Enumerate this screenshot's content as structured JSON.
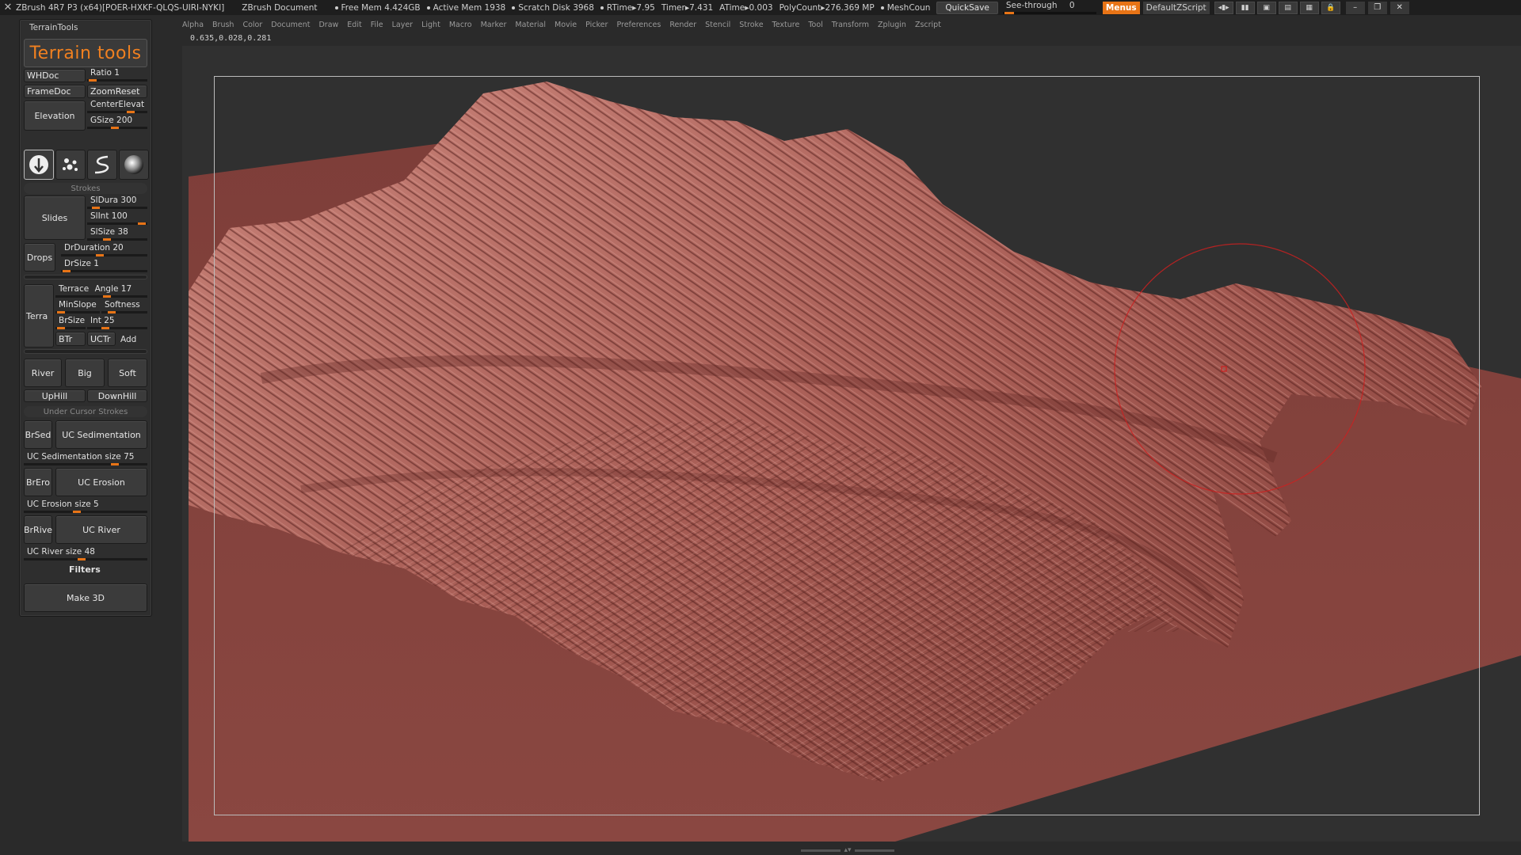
{
  "titlebar": {
    "app_title": "ZBrush 4R7 P3 (x64)[POER-HXKF-QLQS-UIRI-NYKI]",
    "doc_title": "ZBrush Document",
    "stats": [
      "Free Mem 4.424GB",
      "Active Mem 1938",
      "Scratch Disk 3968",
      "RTime▸7.95",
      "Timer▸7.431",
      "ATime▸0.003",
      "PolyCount▸276.369 MP",
      "MeshCoun"
    ],
    "quicksave_label": "QuickSave",
    "seethrough_label": "See-through",
    "seethrough_value": "0",
    "menus_label": "Menus",
    "script_label": "DefaultZScript"
  },
  "menubar": {
    "items": [
      "Alpha",
      "Brush",
      "Color",
      "Document",
      "Draw",
      "Edit",
      "File",
      "Layer",
      "Light",
      "Macro",
      "Marker",
      "Material",
      "Movie",
      "Picker",
      "Preferences",
      "Render",
      "Stencil",
      "Stroke",
      "Texture",
      "Tool",
      "Transform",
      "Zplugin",
      "Zscript"
    ]
  },
  "coords": "0.635,0.028,0.281",
  "palette": {
    "title": "TerrainTools",
    "banner": "Terrain tools",
    "whdoc": "WHDoc",
    "ratio": "Ratio 1",
    "framedoc": "FrameDoc",
    "zoomreset": "ZoomReset",
    "elevation": "Elevation",
    "centerelevat": "CenterElevat",
    "gsize": "GSize 200",
    "strokes_header": "Strokes",
    "slides": "Slides",
    "sldura": "SlDura 300",
    "slint": "SlInt 100",
    "slsize": "SlSize 38",
    "drops": "Drops",
    "drduration": "DrDuration 20",
    "drsize": "DrSize 1",
    "terra": "Terra",
    "terrace": "Terrace",
    "angle": "Angle 17",
    "minslope": "MinSlope",
    "softness": "Softness",
    "brsize": "BrSize",
    "int": "Int 25",
    "btr": "BTr",
    "uctr": "UCTr",
    "add": "Add",
    "river": "River",
    "big": "Big",
    "soft": "Soft",
    "uphill": "UpHill",
    "downhill": "DownHill",
    "under_cursor_header": "Under Cursor Strokes",
    "brsed": "BrSed",
    "uc_sedimentation": "UC Sedimentation",
    "uc_sedimentation_size": "UC Sedimentation size 75",
    "brero": "BrEro",
    "uc_erosion": "UC Erosion",
    "uc_erosion_size": "UC Erosion size 5",
    "brrive": "BrRive",
    "uc_river": "UC River",
    "uc_river_size": "UC River size 48",
    "filters": "Filters",
    "make3d": "Make 3D"
  },
  "colors": {
    "accent": "#e87416",
    "terrain": "#b86a62",
    "terrain_shadow": "#7a3a34",
    "terrain_plane": "#8a4540",
    "canvas_bg": "#303030",
    "brush_cursor": "#cc2020"
  },
  "icons": {
    "logo": "zbrush-logo-icon",
    "stroke_icons": [
      "drag-down-stroke-icon",
      "spray-stroke-icon",
      "freehand-stroke-icon",
      "sphere-alpha-icon"
    ]
  },
  "bottom_nav": "▴▾"
}
